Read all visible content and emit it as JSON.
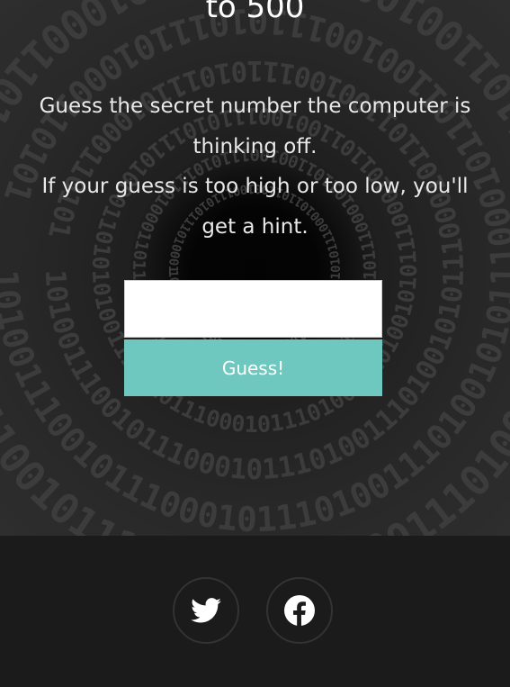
{
  "hero": {
    "title": "to 500",
    "description_line_1": "Guess the secret number the computer is thinking off.",
    "description_line_2": "If your guess is too high or too low, you'll get a hint.",
    "background_pattern_text": "1010011100101110001011101001110100101011100010110110010011101011101000110101"
  },
  "form": {
    "input_value": "",
    "button_label": "Guess!"
  },
  "footer": {
    "social_links": [
      {
        "icon": "twitter-icon"
      },
      {
        "icon": "facebook-icon"
      }
    ]
  },
  "colors": {
    "accent": "#6fc8bf",
    "background": "#1b1b1b",
    "text": "#ffffff"
  }
}
